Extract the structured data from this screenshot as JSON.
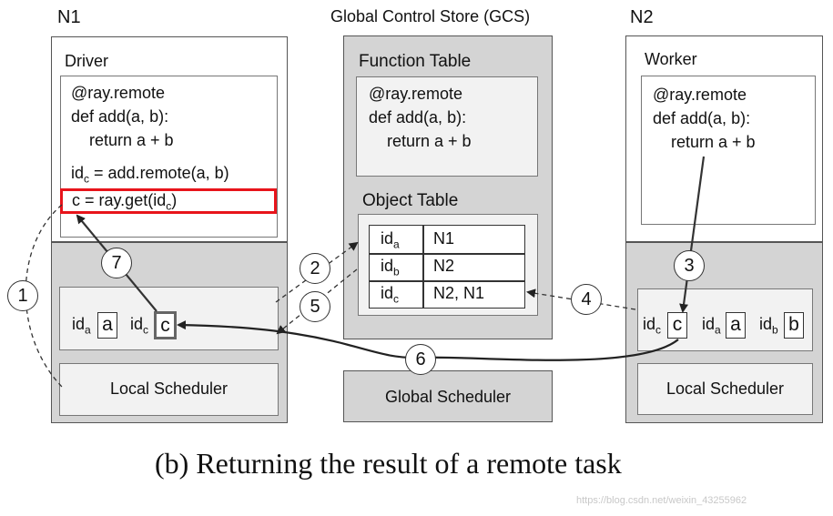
{
  "nodes": {
    "n1": {
      "title": "N1",
      "driver_label": "Driver",
      "code": [
        "@ray.remote",
        "def add(a, b):",
        "    return a + b"
      ],
      "idc_assign": {
        "prefix": "id",
        "sub": "c",
        "rest": " = add.remote(a, b)"
      },
      "get_line": {
        "prefix": "c = ray.get(id",
        "sub": "c",
        "suffix": ")"
      },
      "store": [
        {
          "id": "id",
          "sub": "a",
          "val": "a"
        },
        {
          "id": "id",
          "sub": "c",
          "val": "c"
        }
      ],
      "local_scheduler": "Local Scheduler"
    },
    "gcs": {
      "title": "Global Control Store (GCS)",
      "function_table_label": "Function Table",
      "function_code": [
        "@ray.remote",
        "def add(a, b):",
        "    return a + b"
      ],
      "object_table_label": "Object Table",
      "object_rows": [
        {
          "id": "id",
          "sub": "a",
          "loc": "N1"
        },
        {
          "id": "id",
          "sub": "b",
          "loc": "N2"
        },
        {
          "id": "id",
          "sub": "c",
          "loc": "N2, N1"
        }
      ],
      "global_scheduler": "Global Scheduler"
    },
    "n2": {
      "title": "N2",
      "worker_label": "Worker",
      "code": [
        "@ray.remote",
        "def add(a, b):",
        "    return a + b"
      ],
      "store": [
        {
          "id": "id",
          "sub": "c",
          "val": "c"
        },
        {
          "id": "id",
          "sub": "a",
          "val": "a"
        },
        {
          "id": "id",
          "sub": "b",
          "val": "b"
        }
      ],
      "local_scheduler": "Local Scheduler"
    }
  },
  "steps": [
    "1",
    "2",
    "3",
    "4",
    "5",
    "6",
    "7"
  ],
  "highlight_color": "#e8141b",
  "caption": "(b) Returning the result of a remote task",
  "watermark": "https://blog.csdn.net/weixin_43255962"
}
